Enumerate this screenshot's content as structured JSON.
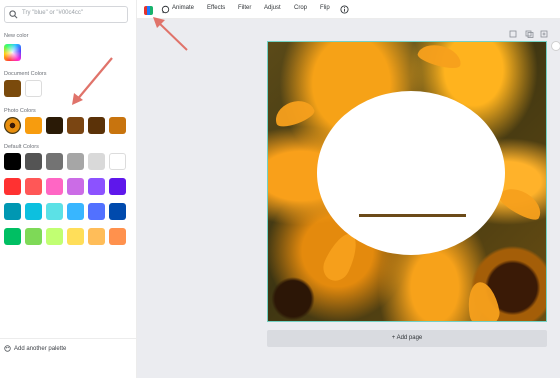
{
  "search": {
    "placeholder": "Try \"blue\" or \"#00c4cc\""
  },
  "sections": {
    "new_color": "New color",
    "document_colors": "Document Colors",
    "photo_colors": "Photo Colors",
    "default_colors": "Default Colors"
  },
  "document_colors": [
    "#7a4a0c",
    "#ffffff"
  ],
  "photo_colors": [
    "#f79c0e",
    "#2a1a06",
    "#7a4512",
    "#5b3208",
    "#c8740e"
  ],
  "default_colors": [
    [
      "#000000",
      "#545454",
      "#737373",
      "#a6a6a6",
      "#d9d9d9",
      "#ffffff"
    ],
    [
      "#ff3131",
      "#ff5757",
      "#ff66c4",
      "#cb6ce6",
      "#8c52ff",
      "#5e17eb"
    ],
    [
      "#0097b2",
      "#0cc0df",
      "#5ce1e6",
      "#38b6ff",
      "#5271ff",
      "#004aad"
    ],
    [
      "#00bf63",
      "#7ed957",
      "#c1ff72",
      "#ffde59",
      "#ffbd59",
      "#ff914d"
    ]
  ],
  "add_palette_label": "Add another palette",
  "toolbar": {
    "animate": "Animate",
    "effects": "Effects",
    "filter": "Filter",
    "adjust": "Adjust",
    "crop": "Crop",
    "flip": "Flip"
  },
  "add_page_label": "+ Add page",
  "accent": {
    "selection_border": "#73d1c3",
    "arrow": "#e0736a"
  }
}
